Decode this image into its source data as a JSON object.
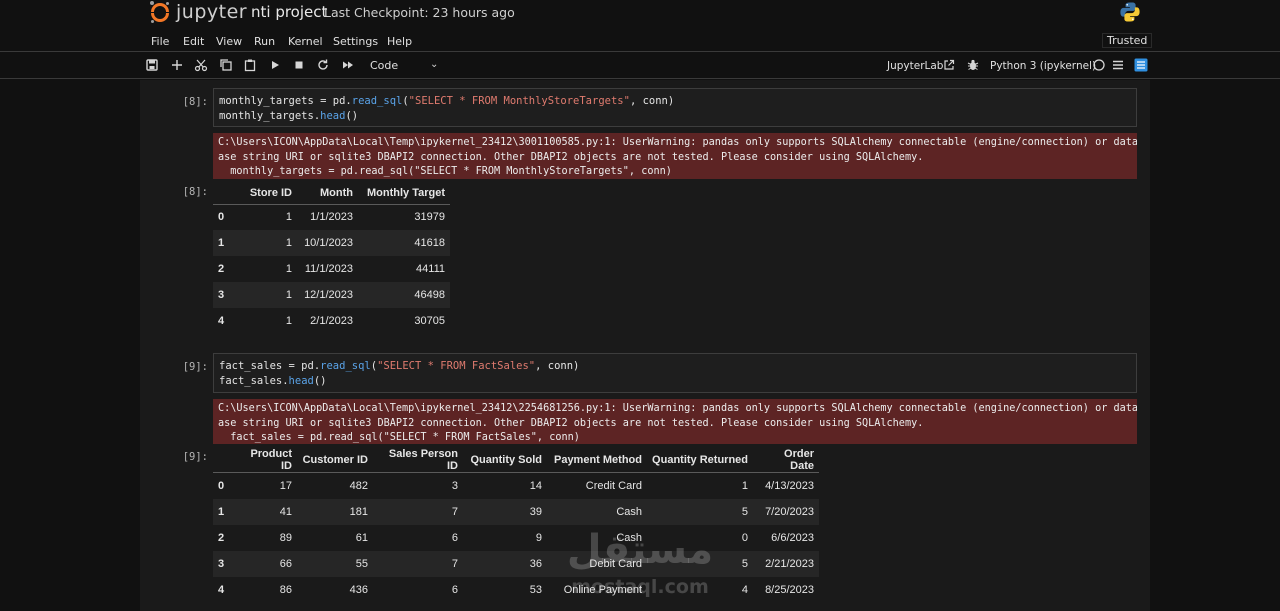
{
  "header": {
    "app_name": "jupyter",
    "notebook_title": "nti project",
    "checkpoint": "Last Checkpoint: 23 hours ago"
  },
  "menu": {
    "items": [
      "File",
      "Edit",
      "View",
      "Run",
      "Kernel",
      "Settings",
      "Help"
    ],
    "trusted": "Trusted"
  },
  "toolbar": {
    "cell_type": "Code",
    "jupyterlab_link": "JupyterLab",
    "kernel": "Python 3 (ipykernel)"
  },
  "cells": [
    {
      "in_prompt": "[8]:",
      "code_line1_a": "monthly_targets = pd.",
      "code_line1_fn": "read_sql",
      "code_line1_b": "(",
      "code_line1_str": "\"SELECT * FROM MonthlyStoreTargets\"",
      "code_line1_c": ", conn)",
      "code_line2_a": "monthly_targets.",
      "code_line2_fn": "head",
      "code_line2_b": "()",
      "stderr_lines": [
        "C:\\Users\\ICON\\AppData\\Local\\Temp\\ipykernel_23412\\3001100585.py:1: UserWarning: pandas only supports SQLAlchemy connectable (engine/connection) or datab",
        "ase string URI or sqlite3 DBAPI2 connection. Other DBAPI2 objects are not tested. Please consider using SQLAlchemy.",
        "  monthly_targets = pd.read_sql(\"SELECT * FROM MonthlyStoreTargets\", conn)"
      ],
      "out_prompt": "[8]:",
      "table": {
        "columns": [
          "",
          "Store ID",
          "Month",
          "Monthly Target"
        ],
        "rows": [
          [
            "0",
            "1",
            "1/1/2023",
            "31979"
          ],
          [
            "1",
            "1",
            "10/1/2023",
            "41618"
          ],
          [
            "2",
            "1",
            "11/1/2023",
            "44111"
          ],
          [
            "3",
            "1",
            "12/1/2023",
            "46498"
          ],
          [
            "4",
            "1",
            "2/1/2023",
            "30705"
          ]
        ]
      }
    },
    {
      "in_prompt": "[9]:",
      "code_line1_a": "fact_sales = pd.",
      "code_line1_fn": "read_sql",
      "code_line1_b": "(",
      "code_line1_str": "\"SELECT * FROM FactSales\"",
      "code_line1_c": ", conn)",
      "code_line2_a": "fact_sales.",
      "code_line2_fn": "head",
      "code_line2_b": "()",
      "stderr_lines": [
        "C:\\Users\\ICON\\AppData\\Local\\Temp\\ipykernel_23412\\2254681256.py:1: UserWarning: pandas only supports SQLAlchemy connectable (engine/connection) or datab",
        "ase string URI or sqlite3 DBAPI2 connection. Other DBAPI2 objects are not tested. Please consider using SQLAlchemy.",
        "  fact_sales = pd.read_sql(\"SELECT * FROM FactSales\", conn)"
      ],
      "out_prompt": "[9]:",
      "table": {
        "columns": [
          "",
          "Product ID",
          "Customer ID",
          "Sales Person ID",
          "Quantity Sold",
          "Payment Method",
          "Quantity Returned",
          "Order Date"
        ],
        "rows": [
          [
            "0",
            "17",
            "482",
            "3",
            "14",
            "Credit Card",
            "1",
            "4/13/2023"
          ],
          [
            "1",
            "41",
            "181",
            "7",
            "39",
            "Cash",
            "5",
            "7/20/2023"
          ],
          [
            "2",
            "89",
            "61",
            "6",
            "9",
            "Cash",
            "0",
            "6/6/2023"
          ],
          [
            "3",
            "66",
            "55",
            "7",
            "36",
            "Debit Card",
            "5",
            "2/21/2023"
          ],
          [
            "4",
            "86",
            "436",
            "6",
            "53",
            "Online Payment",
            "4",
            "8/25/2023"
          ]
        ]
      }
    }
  ],
  "watermark": {
    "arabic": "مستقل",
    "latin": "mostaql.com"
  },
  "colors": {
    "background": "#111111",
    "stderr_bg": "#5d2424",
    "function_blue": "#5aa3e8",
    "string_red": "#e07b6f",
    "logo_orange": "#f37726",
    "active_icon": "#2f8fe0"
  }
}
